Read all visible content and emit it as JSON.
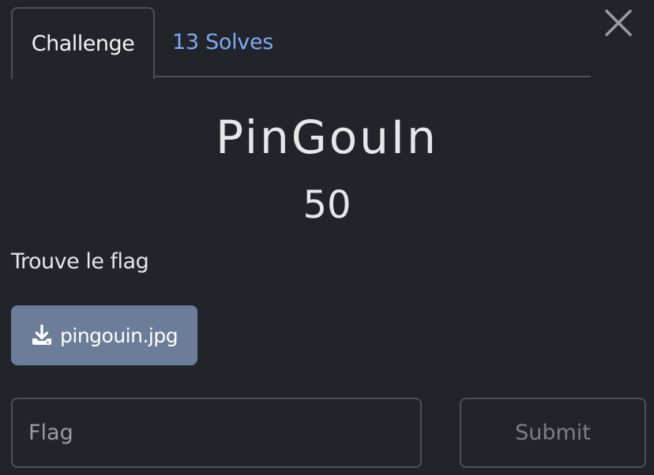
{
  "tabs": [
    {
      "label": "Challenge",
      "active": true
    },
    {
      "label": "13 Solves",
      "active": false
    }
  ],
  "close_icon": "close-icon",
  "challenge": {
    "name": "PinGouIn",
    "points": "50",
    "description": "Trouve le flag"
  },
  "file": {
    "icon": "download-icon",
    "label": "pingouin.jpg"
  },
  "flag": {
    "placeholder": "Flag",
    "value": ""
  },
  "submit_label": "Submit",
  "colors": {
    "background": "#212429",
    "link": "#7ea9f2",
    "file_button": "#6b7d98",
    "border": "#4d5157"
  }
}
